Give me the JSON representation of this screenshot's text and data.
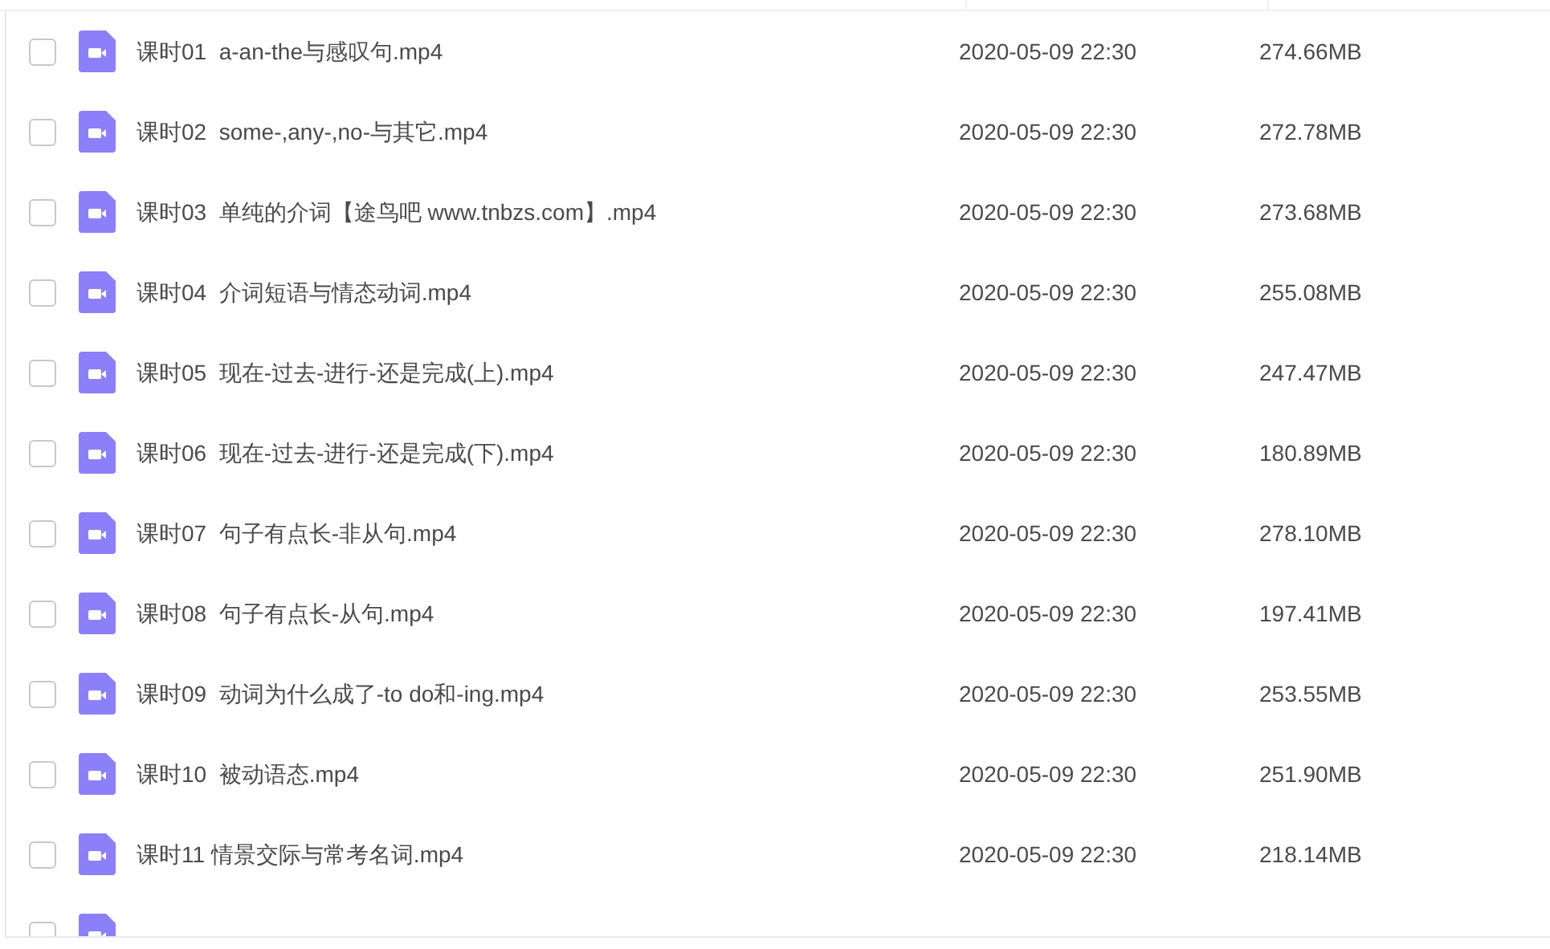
{
  "files": [
    {
      "name": "课时01  a-an-the与感叹句.mp4",
      "modified": "2020-05-09 22:30",
      "size": "274.66MB",
      "checked": false
    },
    {
      "name": "课时02  some-,any-,no-与其它.mp4",
      "modified": "2020-05-09 22:30",
      "size": "272.78MB",
      "checked": false
    },
    {
      "name": "课时03  单纯的介词【途鸟吧 www.tnbzs.com】.mp4",
      "modified": "2020-05-09 22:30",
      "size": "273.68MB",
      "checked": false
    },
    {
      "name": "课时04  介词短语与情态动词.mp4",
      "modified": "2020-05-09 22:30",
      "size": "255.08MB",
      "checked": false
    },
    {
      "name": "课时05  现在-过去-进行-还是完成(上).mp4",
      "modified": "2020-05-09 22:30",
      "size": "247.47MB",
      "checked": false
    },
    {
      "name": "课时06  现在-过去-进行-还是完成(下).mp4",
      "modified": "2020-05-09 22:30",
      "size": "180.89MB",
      "checked": false
    },
    {
      "name": "课时07  句子有点长-非从句.mp4",
      "modified": "2020-05-09 22:30",
      "size": "278.10MB",
      "checked": false
    },
    {
      "name": "课时08  句子有点长-从句.mp4",
      "modified": "2020-05-09 22:30",
      "size": "197.41MB",
      "checked": false
    },
    {
      "name": "课时09  动词为什么成了-to do和-ing.mp4",
      "modified": "2020-05-09 22:30",
      "size": "253.55MB",
      "checked": false
    },
    {
      "name": "课时10  被动语态.mp4",
      "modified": "2020-05-09 22:30",
      "size": "251.90MB",
      "checked": false
    },
    {
      "name": "课时11 情景交际与常考名词.mp4",
      "modified": "2020-05-09 22:30",
      "size": "218.14MB",
      "checked": false
    },
    {
      "checked": false
    }
  ]
}
